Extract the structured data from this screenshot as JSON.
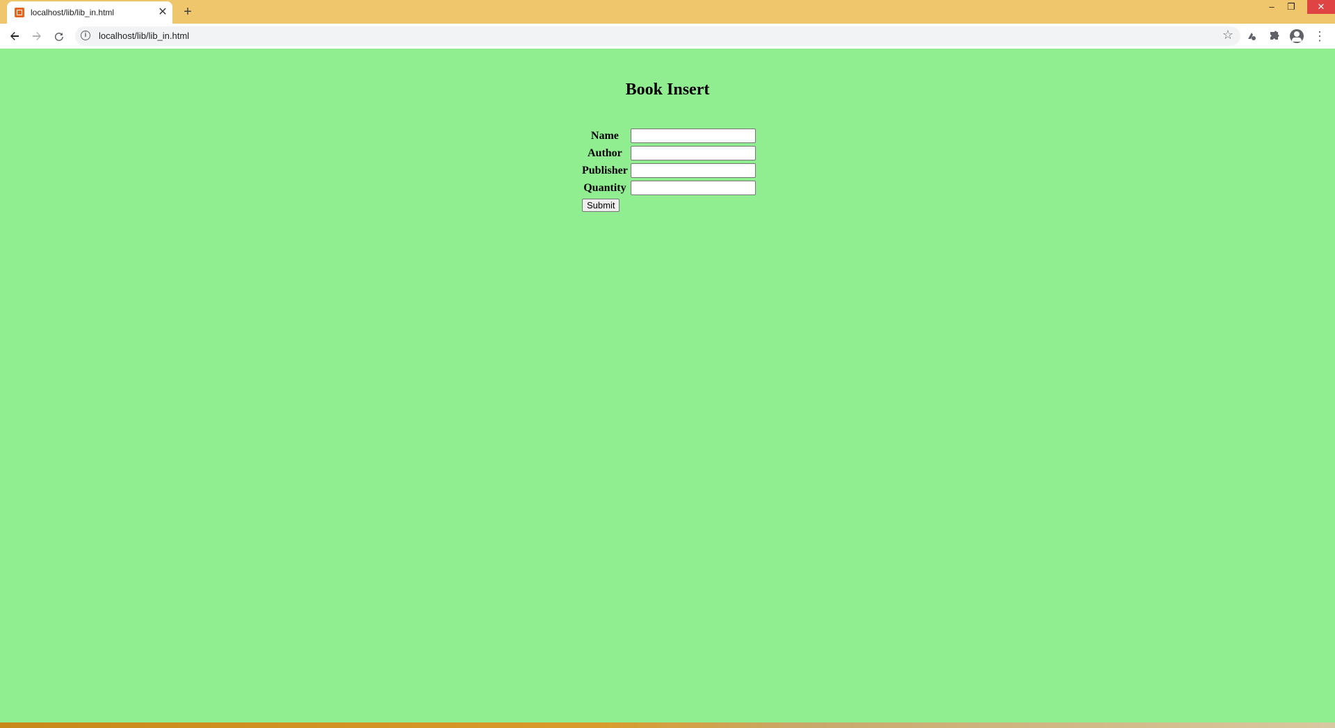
{
  "browser": {
    "tab_title": "localhost/lib/lib_in.html",
    "tab_close": "✕",
    "new_tab": "+",
    "url": "localhost/lib/lib_in.html",
    "window": {
      "minimize": "–",
      "maximize": "❐",
      "close": "✕"
    },
    "icons": {
      "back": "back-arrow-icon",
      "forward": "forward-arrow-icon",
      "reload": "reload-icon",
      "site_info": "info-icon",
      "bookmark": "star-icon",
      "extension": "extension-icon",
      "extensions_menu": "puzzle-icon",
      "profile": "profile-icon",
      "menu": "kebab-menu-icon"
    },
    "tabstrip_color": "#f0c66c"
  },
  "page": {
    "background": "#90ee90",
    "title": "Book Insert",
    "form": {
      "fields": [
        {
          "label": "Name",
          "value": ""
        },
        {
          "label": "Author",
          "value": ""
        },
        {
          "label": "Publisher",
          "value": ""
        },
        {
          "label": "Quantity",
          "value": ""
        }
      ],
      "submit_label": "Submit"
    }
  }
}
